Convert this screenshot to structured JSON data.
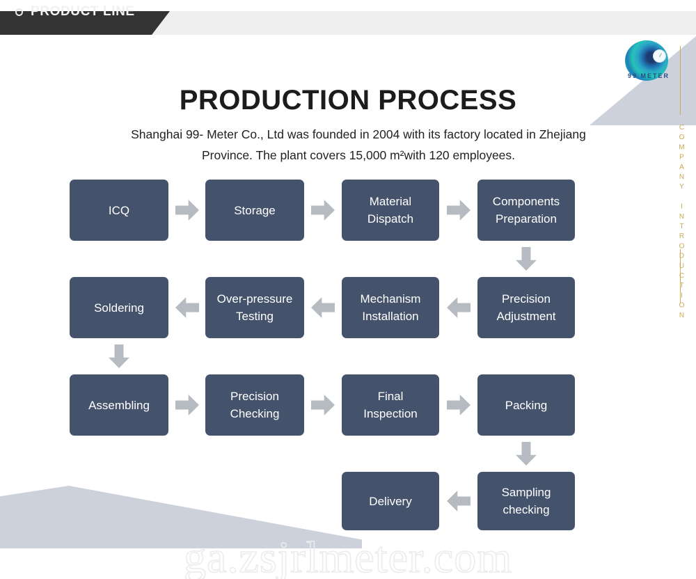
{
  "header": {
    "tab_label": "PRODUCT LINE",
    "bullet_icon": "circle-outline-icon"
  },
  "logo": {
    "brand_text": "99 METER",
    "icon": "swirl-gauge-logo-icon"
  },
  "rail": {
    "vertical_text": "COMPANY INTRODUCTION",
    "line_color": "#cbab5e",
    "text_color": "#c8a952"
  },
  "title": "PRODUCTION PROCESS",
  "subtitle": "Shanghai 99- Meter Co., Ltd was founded in 2004 with its factory located in Zhejiang Province. The plant covers 15,000 m²with 120 employees.",
  "watermark": "ga.zsjrlmeter.com",
  "colors": {
    "node_fill": "#44536b",
    "node_text": "#ffffff",
    "arrow_fill": "#b6bac1",
    "banner_dark": "#333333",
    "banner_gray": "#eeeeee",
    "decor_shape": "#ccd1dc"
  },
  "flow": {
    "nodes": [
      {
        "id": "icq",
        "label": "ICQ"
      },
      {
        "id": "storage",
        "label": "Storage"
      },
      {
        "id": "material-dispatch",
        "label": "Material\nDispatch"
      },
      {
        "id": "components-prep",
        "label": "Components\nPreparation"
      },
      {
        "id": "precision-adjustment",
        "label": "Precision\nAdjustment"
      },
      {
        "id": "mechanism-install",
        "label": "Mechanism\nInstallation"
      },
      {
        "id": "over-pressure-test",
        "label": "Over-pressure\nTesting"
      },
      {
        "id": "soldering",
        "label": "Soldering"
      },
      {
        "id": "assembling",
        "label": "Assembling"
      },
      {
        "id": "precision-checking",
        "label": "Precision\nChecking"
      },
      {
        "id": "final-inspection",
        "label": "Final\nInspection"
      },
      {
        "id": "packing",
        "label": "Packing"
      },
      {
        "id": "sampling-checking",
        "label": "Sampling\nchecking"
      },
      {
        "id": "delivery",
        "label": "Delivery"
      }
    ],
    "connectors": [
      {
        "from": "icq",
        "to": "storage",
        "direction": "right"
      },
      {
        "from": "storage",
        "to": "material-dispatch",
        "direction": "right"
      },
      {
        "from": "material-dispatch",
        "to": "components-prep",
        "direction": "right"
      },
      {
        "from": "components-prep",
        "to": "precision-adjustment",
        "direction": "down"
      },
      {
        "from": "precision-adjustment",
        "to": "mechanism-install",
        "direction": "left"
      },
      {
        "from": "mechanism-install",
        "to": "over-pressure-test",
        "direction": "left"
      },
      {
        "from": "over-pressure-test",
        "to": "soldering",
        "direction": "left"
      },
      {
        "from": "soldering",
        "to": "assembling",
        "direction": "down"
      },
      {
        "from": "assembling",
        "to": "precision-checking",
        "direction": "right"
      },
      {
        "from": "precision-checking",
        "to": "final-inspection",
        "direction": "right"
      },
      {
        "from": "final-inspection",
        "to": "packing",
        "direction": "right"
      },
      {
        "from": "packing",
        "to": "sampling-checking",
        "direction": "down"
      },
      {
        "from": "sampling-checking",
        "to": "delivery",
        "direction": "left"
      }
    ]
  }
}
